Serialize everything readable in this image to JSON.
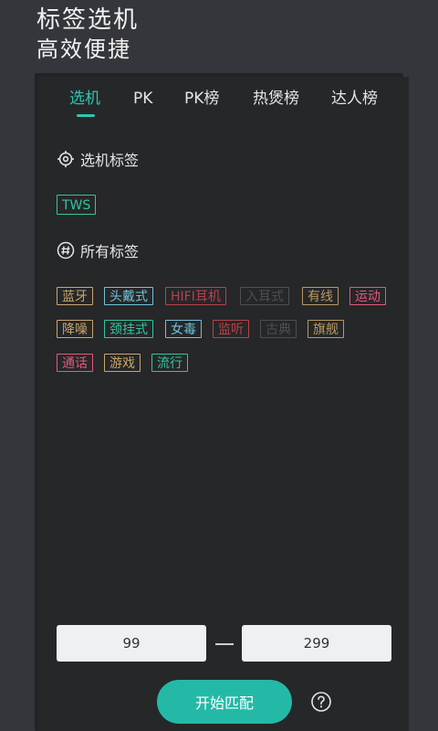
{
  "header": {
    "title": "标签选机",
    "subtitle": "高效便捷"
  },
  "tabs": [
    {
      "label": "选机",
      "active": true
    },
    {
      "label": "PK",
      "active": false
    },
    {
      "label": "PK榜",
      "active": false
    },
    {
      "label": "热煲榜",
      "active": false
    },
    {
      "label": "达人榜",
      "active": false
    }
  ],
  "selected_section": {
    "title": "选机标签",
    "icon": "target-icon",
    "tags": [
      {
        "label": "TWS",
        "color": "#2ec7a0"
      }
    ]
  },
  "all_section": {
    "title": "所有标签",
    "icon": "hash-icon",
    "tags": [
      {
        "label": "蓝牙",
        "color": "#c9a66b"
      },
      {
        "label": "头戴式",
        "color": "#6ec3d8"
      },
      {
        "label": "HIFI耳机",
        "color": "#b8424a"
      },
      {
        "label": "入耳式",
        "color": "#4e4f52"
      },
      {
        "label": "有线",
        "color": "#b99a5f"
      },
      {
        "label": "运动",
        "color": "#e25a7a"
      },
      {
        "label": "降噪",
        "color": "#c9a66b"
      },
      {
        "label": "颈挂式",
        "color": "#2ec7a0"
      },
      {
        "label": "女毒",
        "color": "#6ec3d8"
      },
      {
        "label": "监听",
        "color": "#b8424a"
      },
      {
        "label": "古典",
        "color": "#4e4f52"
      },
      {
        "label": "旗舰",
        "color": "#b99a5f"
      },
      {
        "label": "通话",
        "color": "#e25a7a"
      },
      {
        "label": "游戏",
        "color": "#c9a66b"
      },
      {
        "label": "流行",
        "color": "#2ec7a0"
      }
    ]
  },
  "price_range": {
    "min": "99",
    "max": "299"
  },
  "actions": {
    "start_label": "开始匹配",
    "help_icon": "help-icon"
  },
  "colors": {
    "accent": "#2ec7b3",
    "button": "#24b9a7",
    "card": "#262729",
    "background": "#35363b"
  }
}
